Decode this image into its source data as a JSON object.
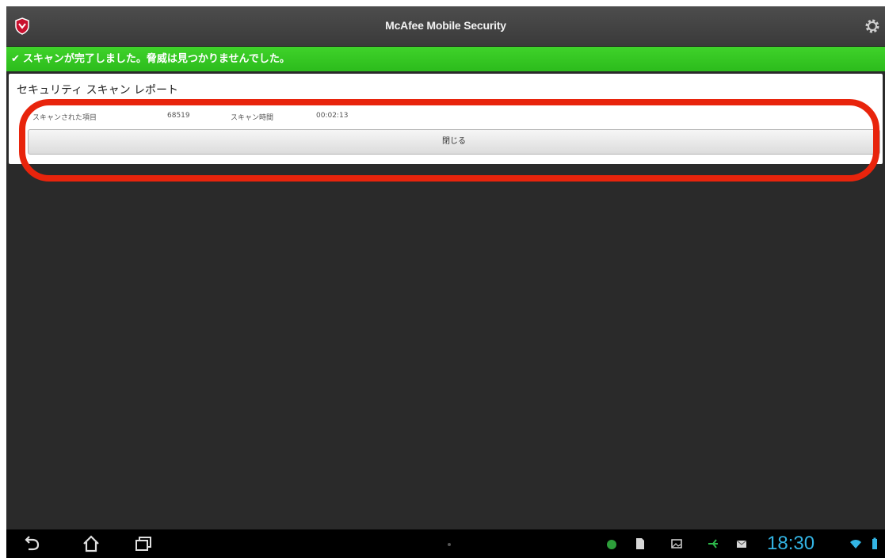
{
  "app": {
    "title": "McAfee Mobile Security"
  },
  "banner": {
    "check": "✔",
    "message": "スキャンが完了しました。脅威は見つかりませんでした。"
  },
  "report": {
    "title": "セキュリティ スキャン レポート",
    "scanned_label": "スキャンされた項目",
    "scanned_value": "68519",
    "time_label": "スキャン時間",
    "time_value": "00:02:13",
    "close_label": "閉じる"
  },
  "status_bar": {
    "time": "18:30"
  },
  "colors": {
    "banner_green": "#2cbc1c",
    "highlight_red": "#e8240c",
    "clock_blue": "#33b5e5"
  }
}
